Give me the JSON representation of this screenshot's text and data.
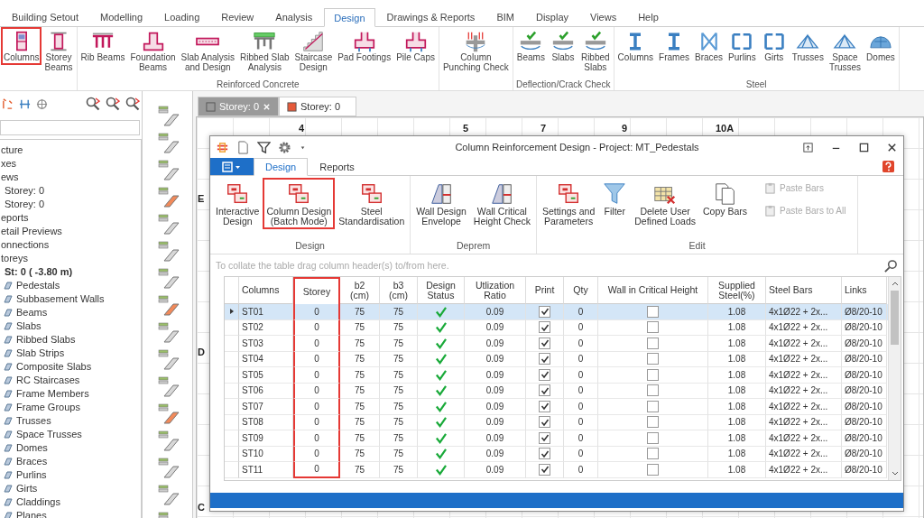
{
  "menu_tabs": [
    {
      "label": "Building Setout",
      "selected": false
    },
    {
      "label": "Modelling",
      "selected": false
    },
    {
      "label": "Loading",
      "selected": false
    },
    {
      "label": "Review",
      "selected": false
    },
    {
      "label": "Analysis",
      "selected": false
    },
    {
      "label": "Design",
      "selected": true
    },
    {
      "label": "Drawings & Reports",
      "selected": false
    },
    {
      "label": "BIM",
      "selected": false
    },
    {
      "label": "Display",
      "selected": false
    },
    {
      "label": "Views",
      "selected": false
    },
    {
      "label": "Help",
      "selected": false
    }
  ],
  "ribbon": {
    "groups": [
      {
        "buttons": [
          {
            "label": "Columns",
            "kind": "rc",
            "highlighted": true
          },
          {
            "label": "Storey\nBeams",
            "kind": "frame",
            "highlighted": false
          }
        ]
      },
      {
        "label": "Reinforced Concrete",
        "buttons": [
          {
            "label": "Rib Beams",
            "kind": "beam",
            "highlighted": false
          },
          {
            "label": "Foundation\nBeams",
            "kind": "foundation",
            "highlighted": false
          },
          {
            "label": "Slab Analysis\nand Design",
            "kind": "slab",
            "highlighted": false
          },
          {
            "label": "Ribbed Slab\nAnalysis",
            "kind": "ribbed",
            "highlighted": false
          },
          {
            "label": "Staircase\nDesign",
            "kind": "stair",
            "highlighted": false
          },
          {
            "label": "Pad Footings",
            "kind": "footing",
            "highlighted": false
          },
          {
            "label": "Pile Caps",
            "kind": "footing",
            "highlighted": false
          }
        ]
      },
      {
        "buttons": [
          {
            "label": "Column\nPunching Check",
            "kind": "punch",
            "highlighted": false
          }
        ]
      },
      {
        "label": "Deflection/Crack Check",
        "buttons": [
          {
            "label": "Beams",
            "kind": "check",
            "highlighted": false
          },
          {
            "label": "Slabs",
            "kind": "check",
            "highlighted": false
          },
          {
            "label": "Ribbed\nSlabs",
            "kind": "check",
            "highlighted": false
          }
        ]
      },
      {
        "label": "Steel",
        "buttons": [
          {
            "label": "Columns",
            "kind": "steel",
            "highlighted": false
          },
          {
            "label": "Frames",
            "kind": "steel",
            "highlighted": false
          },
          {
            "label": "Braces",
            "kind": "brace",
            "highlighted": false
          },
          {
            "label": "Purlins",
            "kind": "purlin",
            "highlighted": false
          },
          {
            "label": "Girts",
            "kind": "purlin",
            "highlighted": false
          },
          {
            "label": "Trusses",
            "kind": "truss",
            "highlighted": false
          },
          {
            "label": "Space\nTrusses",
            "kind": "truss",
            "highlighted": false
          },
          {
            "label": "Domes",
            "kind": "dome",
            "highlighted": false
          }
        ]
      }
    ]
  },
  "tree": [
    {
      "label": "cture"
    },
    {
      "label": "xes"
    },
    {
      "label": "ews",
      "children": [
        {
          "label": "Storey: 0"
        },
        {
          "label": "Storey: 0"
        }
      ]
    },
    {
      "label": "eports"
    },
    {
      "label": "etail Previews"
    },
    {
      "label": "onnections"
    },
    {
      "label": "toreys",
      "children": [
        {
          "label": "St: 0 ( -3.80 m)",
          "bold": true,
          "children": [
            {
              "label": "Pedestals"
            },
            {
              "label": "Subbasement Walls"
            },
            {
              "label": "Beams"
            },
            {
              "label": "Slabs"
            },
            {
              "label": "Ribbed Slabs"
            },
            {
              "label": "Slab Strips"
            },
            {
              "label": "Composite Slabs"
            },
            {
              "label": "RC Staircases"
            },
            {
              "label": "Frame Members"
            },
            {
              "label": "Frame Groups"
            },
            {
              "label": "Trusses"
            },
            {
              "label": "Space Trusses"
            },
            {
              "label": "Domes"
            },
            {
              "label": "Braces"
            },
            {
              "label": "Purlins"
            },
            {
              "label": "Girts"
            },
            {
              "label": "Claddings"
            },
            {
              "label": "Planes"
            }
          ]
        }
      ]
    }
  ],
  "document_tabs": [
    {
      "label": "Storey: 0",
      "selected": true
    },
    {
      "label": "Storey: 0",
      "selected": false
    }
  ],
  "canvas": {
    "axis_numbers": [
      "4",
      "5",
      "7",
      "9",
      "10A"
    ],
    "axis_letters": [
      "E",
      "D",
      "C"
    ]
  },
  "dialog": {
    "title": "Column Reinforcement Design - Project: MT_Pedestals",
    "tabs": [
      {
        "label": "Design",
        "selected": true
      },
      {
        "label": "Reports",
        "selected": false
      }
    ],
    "groups": [
      {
        "label": "Design",
        "buttons": [
          {
            "label": "Interactive\nDesign",
            "kind": "frames",
            "disabled": false,
            "highlighted": false
          },
          {
            "label": "Column Design\n(Batch Mode)",
            "kind": "frames",
            "disabled": false,
            "highlighted": true
          },
          {
            "label": "Steel\nStandardisation",
            "kind": "frames",
            "disabled": false,
            "highlighted": false
          }
        ]
      },
      {
        "label": "Deprem",
        "buttons": [
          {
            "label": "Wall Design\nEnvelope",
            "kind": "wall",
            "disabled": false,
            "highlighted": false
          },
          {
            "label": "Wall Critical\nHeight Check",
            "kind": "wall",
            "disabled": false,
            "highlighted": false
          }
        ]
      },
      {
        "label": "Edit",
        "buttons": [
          {
            "label": "Settings and\nParameters",
            "kind": "frames",
            "disabled": false,
            "highlighted": false
          },
          {
            "label": "Filter",
            "kind": "funnel",
            "disabled": false,
            "highlighted": false
          },
          {
            "label": "Delete User\nDefined Loads",
            "kind": "tablex",
            "disabled": false,
            "highlighted": false
          },
          {
            "label": "Copy Bars",
            "kind": "pages",
            "disabled": false,
            "highlighted": false
          },
          {
            "label": "Paste Bars",
            "kind": "clipboard",
            "disabled": true,
            "highlighted": false
          },
          {
            "label": "Paste Bars to All",
            "kind": "clipboard",
            "disabled": true,
            "highlighted": false
          }
        ]
      }
    ],
    "group_hint": "To collate the table drag column header(s) to/from here.",
    "table": {
      "columns": [
        {
          "label": "Columns",
          "highlighted": false
        },
        {
          "label": "Storey",
          "highlighted": true
        },
        {
          "label": "b2\n(cm)",
          "highlighted": false
        },
        {
          "label": "b3\n(cm)",
          "highlighted": false
        },
        {
          "label": "Design\nStatus",
          "highlighted": false
        },
        {
          "label": "Utlization\nRatio",
          "highlighted": false
        },
        {
          "label": "Print",
          "highlighted": false
        },
        {
          "label": "Qty",
          "highlighted": false
        },
        {
          "label": "Wall in Critical Height",
          "highlighted": false
        },
        {
          "label": "Supplied\nSteel(%)",
          "highlighted": false
        },
        {
          "label": "Steel Bars",
          "highlighted": false
        },
        {
          "label": "Links",
          "highlighted": false
        }
      ],
      "rows": [
        {
          "column": "ST01",
          "storey": "0",
          "b2": "75",
          "b3": "75",
          "design_ok": true,
          "ratio": "0.09",
          "print": true,
          "qty": "0",
          "wall_critical": false,
          "steel": "1.08",
          "bars": "4x1Ø22 + 2x...",
          "links": "Ø8/20-10",
          "selected": true
        },
        {
          "column": "ST02",
          "storey": "0",
          "b2": "75",
          "b3": "75",
          "design_ok": true,
          "ratio": "0.09",
          "print": true,
          "qty": "0",
          "wall_critical": false,
          "steel": "1.08",
          "bars": "4x1Ø22 + 2x...",
          "links": "Ø8/20-10",
          "selected": false
        },
        {
          "column": "ST03",
          "storey": "0",
          "b2": "75",
          "b3": "75",
          "design_ok": true,
          "ratio": "0.09",
          "print": true,
          "qty": "0",
          "wall_critical": false,
          "steel": "1.08",
          "bars": "4x1Ø22 + 2x...",
          "links": "Ø8/20-10",
          "selected": false
        },
        {
          "column": "ST04",
          "storey": "0",
          "b2": "75",
          "b3": "75",
          "design_ok": true,
          "ratio": "0.09",
          "print": true,
          "qty": "0",
          "wall_critical": false,
          "steel": "1.08",
          "bars": "4x1Ø22 + 2x...",
          "links": "Ø8/20-10",
          "selected": false
        },
        {
          "column": "ST05",
          "storey": "0",
          "b2": "75",
          "b3": "75",
          "design_ok": true,
          "ratio": "0.09",
          "print": true,
          "qty": "0",
          "wall_critical": false,
          "steel": "1.08",
          "bars": "4x1Ø22 + 2x...",
          "links": "Ø8/20-10",
          "selected": false
        },
        {
          "column": "ST06",
          "storey": "0",
          "b2": "75",
          "b3": "75",
          "design_ok": true,
          "ratio": "0.09",
          "print": true,
          "qty": "0",
          "wall_critical": false,
          "steel": "1.08",
          "bars": "4x1Ø22 + 2x...",
          "links": "Ø8/20-10",
          "selected": false
        },
        {
          "column": "ST07",
          "storey": "0",
          "b2": "75",
          "b3": "75",
          "design_ok": true,
          "ratio": "0.09",
          "print": true,
          "qty": "0",
          "wall_critical": false,
          "steel": "1.08",
          "bars": "4x1Ø22 + 2x...",
          "links": "Ø8/20-10",
          "selected": false
        },
        {
          "column": "ST08",
          "storey": "0",
          "b2": "75",
          "b3": "75",
          "design_ok": true,
          "ratio": "0.09",
          "print": true,
          "qty": "0",
          "wall_critical": false,
          "steel": "1.08",
          "bars": "4x1Ø22 + 2x...",
          "links": "Ø8/20-10",
          "selected": false
        },
        {
          "column": "ST09",
          "storey": "0",
          "b2": "75",
          "b3": "75",
          "design_ok": true,
          "ratio": "0.09",
          "print": true,
          "qty": "0",
          "wall_critical": false,
          "steel": "1.08",
          "bars": "4x1Ø22 + 2x...",
          "links": "Ø8/20-10",
          "selected": false
        },
        {
          "column": "ST10",
          "storey": "0",
          "b2": "75",
          "b3": "75",
          "design_ok": true,
          "ratio": "0.09",
          "print": true,
          "qty": "0",
          "wall_critical": false,
          "steel": "1.08",
          "bars": "4x1Ø22 + 2x...",
          "links": "Ø8/20-10",
          "selected": false
        },
        {
          "column": "ST11",
          "storey": "0",
          "b2": "75",
          "b3": "75",
          "design_ok": true,
          "ratio": "0.09",
          "print": true,
          "qty": "0",
          "wall_critical": false,
          "steel": "1.08",
          "bars": "4x1Ø22 + 2x...",
          "links": "Ø8/20-10",
          "selected": false
        }
      ]
    }
  }
}
